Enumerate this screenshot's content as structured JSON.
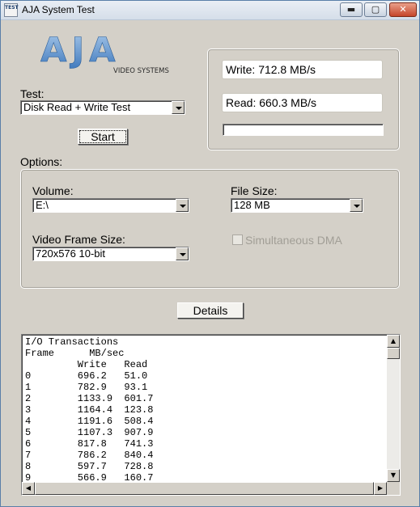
{
  "window": {
    "title": "AJA System Test",
    "icon_label": "TEST",
    "minimize_glyph": "▬",
    "maximize_glyph": "▢",
    "close_glyph": "✕"
  },
  "logo": {
    "brand": "AJA",
    "tagline": "VIDEO SYSTEMS"
  },
  "test": {
    "label": "Test:",
    "selected": "Disk Read + Write Test",
    "start_label": "Start"
  },
  "results": {
    "write": "Write: 712.8 MB/s",
    "read": "Read: 660.3 MB/s",
    "progress": 0
  },
  "options": {
    "label": "Options:",
    "volume_label": "Volume:",
    "volume_value": "E:\\",
    "file_size_label": "File Size:",
    "file_size_value": "128 MB",
    "frame_size_label": "Video Frame Size:",
    "frame_size_value": "720x576 10-bit",
    "dma_label": "Simultaneous DMA",
    "dma_checked": false
  },
  "details_label": "Details",
  "log": {
    "title": "I/O Transactions",
    "col_frame": "Frame",
    "col_unit": "MB/sec",
    "col_write": "Write",
    "col_read": "Read",
    "rows": [
      {
        "frame": "0",
        "write": "696.2",
        "read": "51.0"
      },
      {
        "frame": "1",
        "write": "782.9",
        "read": "93.1"
      },
      {
        "frame": "2",
        "write": "1133.9",
        "read": "601.7"
      },
      {
        "frame": "3",
        "write": "1164.4",
        "read": "123.8"
      },
      {
        "frame": "4",
        "write": "1191.6",
        "read": "508.4"
      },
      {
        "frame": "5",
        "write": "1107.3",
        "read": "907.9"
      },
      {
        "frame": "6",
        "write": "817.8",
        "read": "741.3"
      },
      {
        "frame": "7",
        "write": "786.2",
        "read": "840.4"
      },
      {
        "frame": "8",
        "write": "597.7",
        "read": "728.8"
      },
      {
        "frame": "9",
        "write": "566.9",
        "read": "160.7"
      }
    ]
  },
  "colors": {
    "logo_blue": "#4d87c9",
    "progress_blue": "#2c6fd2"
  }
}
